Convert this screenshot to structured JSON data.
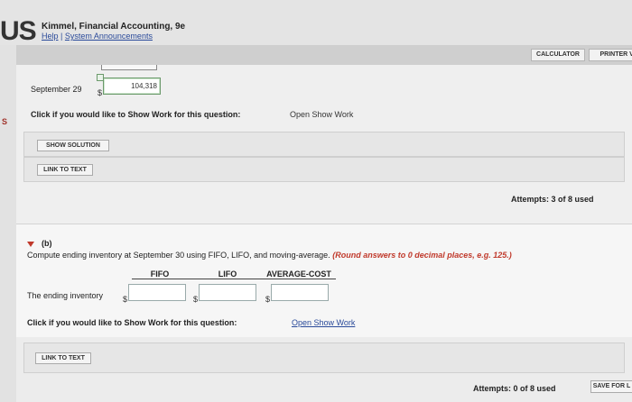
{
  "header": {
    "logo": "US",
    "book_title": "Kimmel, Financial Accounting, 9e",
    "help_link": "Help",
    "separator": "|",
    "announcements_link": "System Announcements"
  },
  "left_rail": {
    "letter": "S"
  },
  "toolbar": {
    "calculator": "CALCULATOR",
    "printer": "PRINTER VE"
  },
  "part_a": {
    "date_label": "September 29",
    "currency": "$",
    "value": "104,318",
    "show_work_prompt": "Click if you would like to Show Work for this question:",
    "show_work_link": "Open Show Work",
    "show_solution_button": "SHOW SOLUTION",
    "link_to_text_button": "LINK TO TEXT",
    "attempts": "Attempts: 3 of 8 used"
  },
  "part_b": {
    "label": "(b)",
    "instruction": "Compute ending inventory at September 30 using FIFO, LIFO, and moving-average.",
    "instruction_note": "(Round answers to 0 decimal places, e.g. 125.)",
    "columns": [
      "FIFO",
      "LIFO",
      "AVERAGE-COST"
    ],
    "row_label": "The ending inventory",
    "currency": "$",
    "inputs": [
      "",
      "",
      ""
    ],
    "show_work_prompt": "Click if you would like to Show Work for this question:",
    "show_work_link": "Open Show Work",
    "link_to_text_button": "LINK TO TEXT",
    "attempts": "Attempts: 0 of 8 used",
    "save_button": "SAVE FOR L"
  }
}
